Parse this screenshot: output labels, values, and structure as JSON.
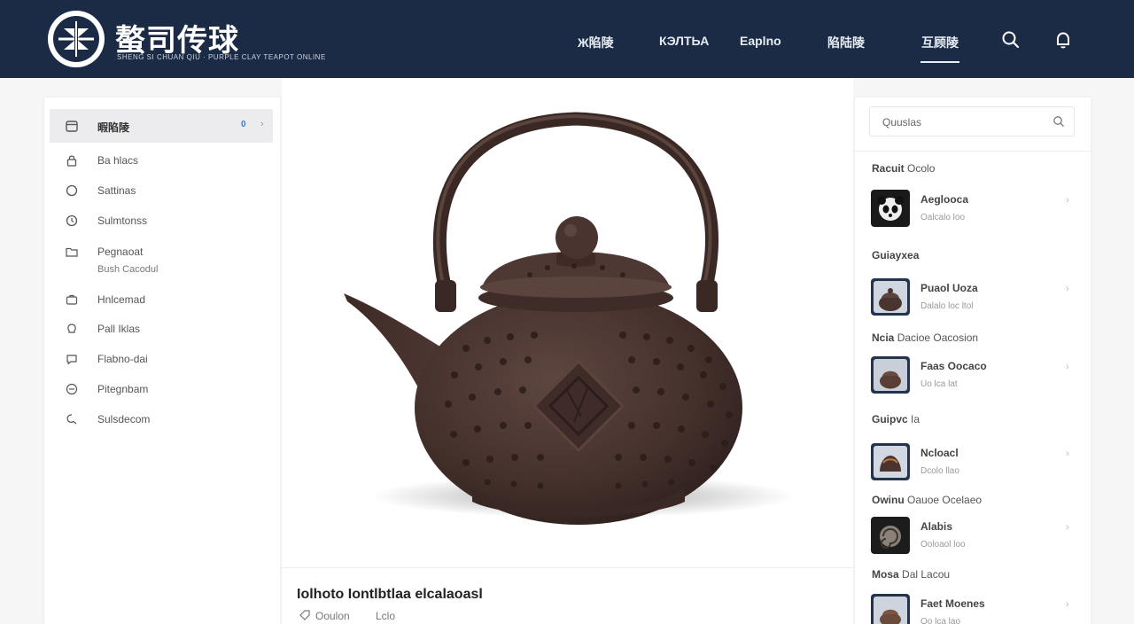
{
  "header": {
    "brand": "螯司传球",
    "brand_sub": "SHENG SI CHUAN QIU · PURPLE CLAY TEAPOT ONLINE",
    "nav": [
      "Ж陷陵",
      "КЭЛТЬА",
      "Eaplno",
      "陷陆陵",
      "互顾陵"
    ],
    "active_nav_index": 4
  },
  "sidebar": {
    "items": [
      {
        "label": "暇陷陵",
        "badge": "0",
        "icon": "calendar-icon"
      },
      {
        "label": "Ba hlacs",
        "icon": "lock-icon"
      },
      {
        "label": "Sattinas",
        "icon": "circle-icon"
      },
      {
        "label": "Sulmtonss",
        "icon": "clock-icon"
      },
      {
        "label": "Pegnaoat",
        "icon": "folder-icon"
      },
      {
        "label": "Hnlcemad",
        "icon": "briefcase-icon"
      },
      {
        "label": "Pall Iklas",
        "icon": "bulb-icon"
      },
      {
        "label": "Flabno-dai",
        "icon": "chat-icon"
      },
      {
        "label": "Pitegnbam",
        "icon": "help-icon"
      },
      {
        "label": "Sulsdecom",
        "icon": "feedback-icon"
      }
    ],
    "sub_label": "Bush Cacodul"
  },
  "main": {
    "title": "Iolhoto Iontlbtlaa elcalaoasl",
    "meta": [
      "Ooulon",
      "Lclo"
    ]
  },
  "right": {
    "search_placeholder": "Quuslas",
    "sections": [
      {
        "heading_bold": "Racuit",
        "heading": "Ocolo",
        "items": [
          {
            "title": "Aeglooca",
            "sub": "Oalcalo loo",
            "thumb": "panda"
          }
        ]
      },
      {
        "heading_bold": "Guiayxea",
        "heading": "",
        "items": [
          {
            "title": "Puaol Uoza",
            "sub": "Dalalo loc ltol",
            "thumb": "teapot"
          }
        ]
      },
      {
        "heading_bold": "Ncia",
        "heading": "Dacioe Oacosion",
        "items": [
          {
            "title": "Faas Oocaco",
            "sub": "Uo lca lat",
            "thumb": "teapot"
          }
        ]
      },
      {
        "heading_bold": "Guipvc",
        "heading": "Ia",
        "items": [
          {
            "title": "Ncloacl",
            "sub": "Dcolo llao",
            "thumb": "teapot"
          }
        ]
      },
      {
        "heading_bold": "Owinu",
        "heading": "Oauoe Ocelaeo",
        "items": [
          {
            "title": "Alabis",
            "sub": "Ooloaol loo",
            "thumb": "shell"
          }
        ]
      },
      {
        "heading_bold": "Mosa",
        "heading": "Dal Lacou",
        "items": [
          {
            "title": "Faet Moenes",
            "sub": "Oo lca lao",
            "thumb": "teapot"
          }
        ]
      }
    ]
  },
  "colors": {
    "header_bg": "#1c2b45",
    "accent_blue": "#3a7fd8",
    "teapot": "#4a3530"
  }
}
